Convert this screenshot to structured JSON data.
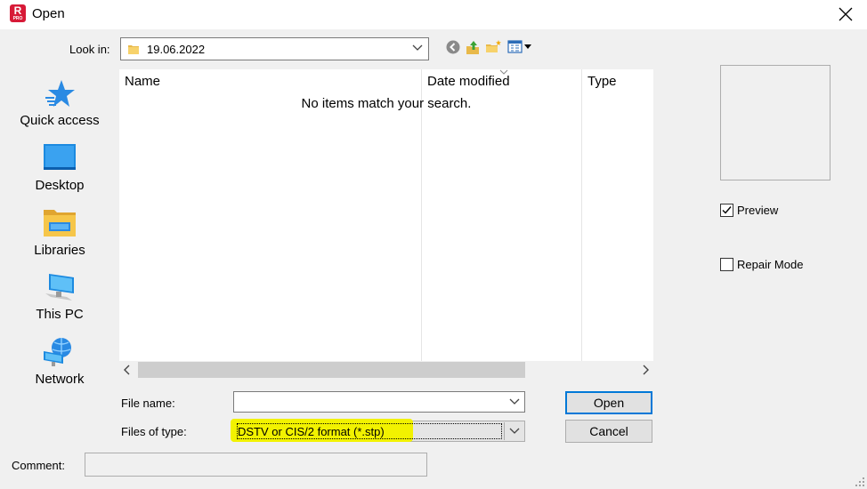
{
  "window": {
    "title": "Open",
    "app_icon_letter": "R",
    "app_icon_sub": "PRO",
    "app_icon_color": "#d71a37"
  },
  "look_in": {
    "label": "Look in:",
    "value": "19.06.2022"
  },
  "toolbar": {
    "icons": [
      "back-icon",
      "up-folder-icon",
      "new-folder-icon",
      "view-menu-icon"
    ]
  },
  "places": [
    {
      "label": "Quick access",
      "icon": "star-icon"
    },
    {
      "label": "Desktop",
      "icon": "desktop-icon"
    },
    {
      "label": "Libraries",
      "icon": "libraries-icon"
    },
    {
      "label": "This PC",
      "icon": "computer-icon"
    },
    {
      "label": "Network",
      "icon": "network-icon"
    }
  ],
  "file_list": {
    "columns": [
      "Name",
      "Date modified",
      "Type"
    ],
    "empty_message": "No items match your search."
  },
  "options": {
    "preview_label": "Preview",
    "preview_checked": true,
    "repair_label": "Repair Mode",
    "repair_checked": false
  },
  "fields": {
    "file_name_label": "File name:",
    "file_name_value": "",
    "file_type_label": "Files of type:",
    "file_type_value": "DSTV or CIS/2 format (*.stp)",
    "comment_label": "Comment:",
    "comment_value": ""
  },
  "buttons": {
    "open": "Open",
    "cancel": "Cancel"
  },
  "colors": {
    "highlight": "#f2f200",
    "default_button_border": "#0078d7"
  }
}
